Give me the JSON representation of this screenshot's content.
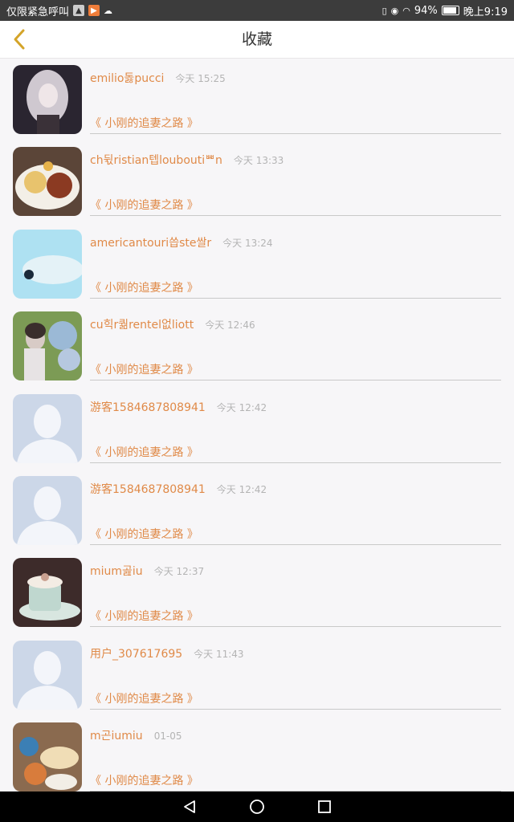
{
  "status_bar": {
    "left_text": "仅限紧急呼叫",
    "battery": "94%",
    "time": "晚上9:19"
  },
  "header": {
    "title": "收藏",
    "back_icon": "chevron-left-icon"
  },
  "favorites": [
    {
      "username": "emilio돓pucci",
      "time": "今天 15:25",
      "title": "《 小刚的追妻之路 》",
      "avatar": "portrait-woman"
    },
    {
      "username": "ch뒧ristian텝louboutiᄤn",
      "time": "今天 13:33",
      "title": "《 小刚的追妻之路 》",
      "avatar": "food-plate"
    },
    {
      "username": "americantouri씁ste쌀r",
      "time": "今天 13:24",
      "title": "《 小刚的追妻之路 》",
      "avatar": "seal-blue"
    },
    {
      "username": "cu힉r퀆rentel없liott",
      "time": "今天 12:46",
      "title": "《 小刚的追妻之路 》",
      "avatar": "girl-flowers"
    },
    {
      "username": "游客1584687808941",
      "time": "今天 12:42",
      "title": "《 小刚的追妻之路 》",
      "avatar": "default-person"
    },
    {
      "username": "游客1584687808941",
      "time": "今天 12:42",
      "title": "《 小刚的追妻之路 》",
      "avatar": "default-person"
    },
    {
      "username": "mium곮iu",
      "time": "今天 12:37",
      "title": "《 小刚的追妻之路 》",
      "avatar": "coffee-cup"
    },
    {
      "username": "用户_307617695",
      "time": "今天 11:43",
      "title": "《 小刚的追妻之路 》",
      "avatar": "default-person"
    },
    {
      "username": "m곤iumiu",
      "time": "01-05",
      "title": "《 小刚的追妻之路 》",
      "avatar": "seashells"
    }
  ],
  "colors": {
    "accent": "#e08a48",
    "time": "#b4b4b4",
    "background": "#f7f6f8"
  },
  "nav_bar": [
    "back-triangle-icon",
    "home-circle-icon",
    "recents-square-icon"
  ]
}
